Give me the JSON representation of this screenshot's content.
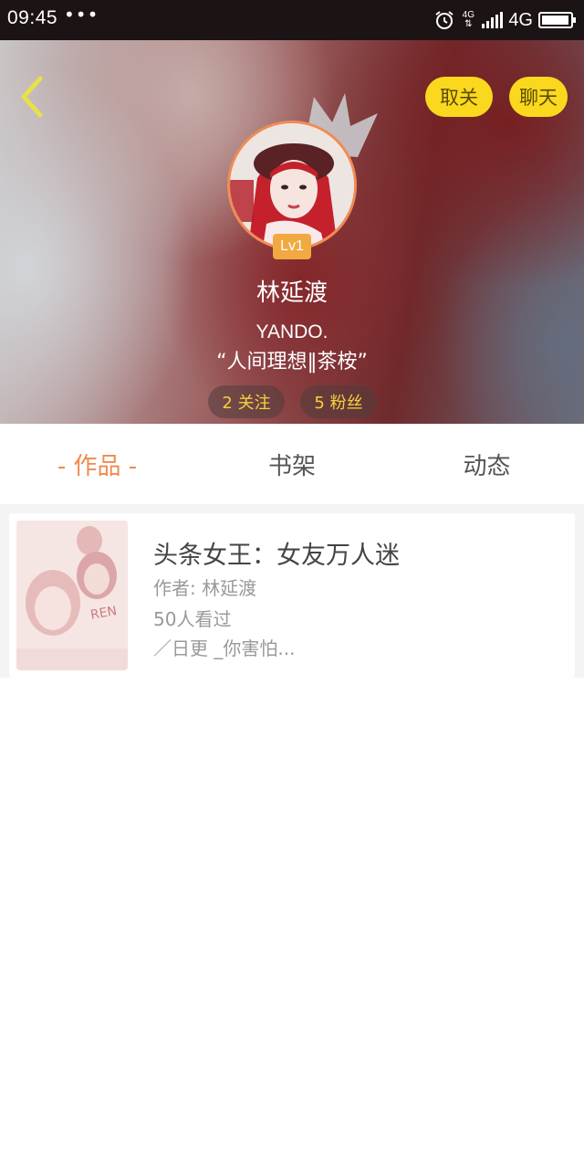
{
  "status_bar": {
    "time": "09:45",
    "dots": "•••",
    "network_small": "4G",
    "network": "4G",
    "icons": [
      "alarm-icon",
      "signal-icon",
      "battery-icon"
    ]
  },
  "header": {
    "unfollow_label": "取关",
    "chat_label": "聊天",
    "level": "Lv1",
    "username": "林延渡",
    "bio_line1": "YANDO.",
    "bio_line2": "“人间理想‖茶桉”",
    "following": "2 关注",
    "fans": "5 粉丝"
  },
  "tabs": {
    "works": "- 作品 -",
    "shelf": "书架",
    "activity": "动态"
  },
  "books": [
    {
      "title": "头条女王：女友万人迷",
      "author": "作者: 林延渡",
      "views": "50人看过",
      "desc": "／日更 _你害怕..."
    }
  ],
  "colors": {
    "accent_yellow": "#f9d81e",
    "accent_orange": "#f0894f",
    "level_badge": "#f2a941",
    "stat_text": "#f7d23a"
  }
}
